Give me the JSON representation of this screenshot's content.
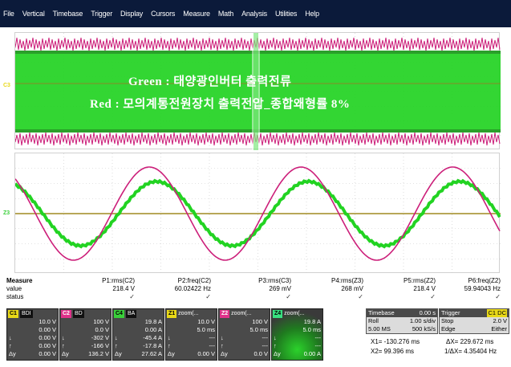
{
  "menu": [
    "File",
    "Vertical",
    "Timebase",
    "Trigger",
    "Display",
    "Cursors",
    "Measure",
    "Math",
    "Analysis",
    "Utilities",
    "Help"
  ],
  "annotations": {
    "line1": "Green : 태양광인버터 출력전류",
    "line2": "Red : 모의계통전원장치 출력전압_종합왜형률 8%"
  },
  "markers": {
    "c3": "C3",
    "z3": "Z3"
  },
  "colors": {
    "green": "#22d322",
    "red": "#cc1f7a",
    "ch1": "#e8d818",
    "ch2": "#e0328a",
    "ch3": "#3ad03a",
    "ch4": "#38e080",
    "zoom": "#e8d818",
    "menubg": "#0b1a3a"
  },
  "measure": {
    "title": "Measure",
    "value_label": "value",
    "status_label": "status",
    "params": [
      {
        "name": "P1:rms(C2)",
        "value": "218.4 V",
        "status": "✓"
      },
      {
        "name": "P2:freq(C2)",
        "value": "60.02422 Hz",
        "status": "✓"
      },
      {
        "name": "P3:rms(C3)",
        "value": "269 mV",
        "status": "✓"
      },
      {
        "name": "P4:rms(Z3)",
        "value": "268 mV",
        "status": "✓"
      },
      {
        "name": "P5:rms(Z2)",
        "value": "218.4 V",
        "status": "✓"
      },
      {
        "name": "P6:freq(Z2)",
        "value": "59.94043 Hz",
        "status": "✓"
      }
    ]
  },
  "channels": [
    {
      "tag": "C1",
      "tag2": "BDI",
      "r1": "10.0 V",
      "r2a": "",
      "r2": "0.00 V",
      "r3a": "↓",
      "r3": "0.00 V",
      "r4a": "↑",
      "r4": "0.00 V",
      "r5a": "Δy",
      "r5": "0.00 V"
    },
    {
      "tag": "C2",
      "tag2": "BD",
      "r1": "100 V",
      "r2a": "",
      "r2": "0.0 V",
      "r3a": "↓",
      "r3": "-302 V",
      "r4a": "↑",
      "r4": "-166 V",
      "r5a": "Δy",
      "r5": "136.2 V"
    },
    {
      "tag": "C4",
      "tag2": "BA",
      "r1": "19.8 A",
      "r2a": "",
      "r2": "0.00 A",
      "r3a": "↓",
      "r3": "-45.4 A",
      "r4a": "↑",
      "r4": "-17.8 A",
      "r5a": "Δy",
      "r5": "27.62 A"
    }
  ],
  "zooms": [
    {
      "tag": "Z1",
      "title": "zoom(...",
      "r1": "10.0 V",
      "r2": "5.0 ms",
      "r3a": "↓",
      "r3": "---",
      "r4a": "↑",
      "r4": "---",
      "r5a": "Δy",
      "r5": "0.00 V"
    },
    {
      "tag": "Z2",
      "title": "zoom(...",
      "r1": "100 V",
      "r2": "5.0 ms",
      "r3a": "↓",
      "r3": "---",
      "r4a": "↑",
      "r4": "---",
      "r5a": "Δy",
      "r5": "0.0 V"
    },
    {
      "tag": "Z4",
      "title": "zoom(...",
      "r1": "19.8 A",
      "r2": "5.0 ms",
      "r3a": "↓",
      "r3": "---",
      "r4a": "↑",
      "r4": "---",
      "r5a": "Δy",
      "r5": "0.00 A"
    }
  ],
  "timebase": {
    "label": "Timebase",
    "offset": "0.00 s",
    "mode": "Roll",
    "rate": "1.00 s/div",
    "samples": "5.00 MS",
    "srate": "500 kS/s"
  },
  "trigger": {
    "label": "Trigger",
    "ch": "C1 DC",
    "mode": "Stop",
    "level": "2.0 V",
    "type": "Edge",
    "slope": "Either"
  },
  "cursors": {
    "x1": "X1= -130.276 ms",
    "dx": "ΔX= 229.672 ms",
    "x2": "X2= 99.396 ms",
    "idx": "1/ΔX= 4.35404 Hz"
  },
  "charts": {
    "top": {
      "cycles": 30,
      "note": "dense high-frequency red/green waveforms with green band"
    },
    "bottom": {
      "cycles": 3.2
    }
  }
}
